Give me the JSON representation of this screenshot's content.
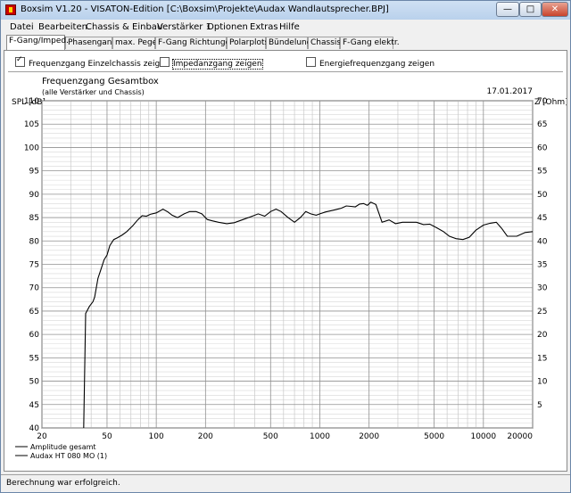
{
  "window": {
    "title": "Boxsim V1.20 - VISATON-Edition [C:\\Boxsim\\Projekte\\Audax Wandlautsprecher.BPJ]",
    "minimize": "—",
    "maximize": "□",
    "close": "✕"
  },
  "menu": [
    "Datei",
    "Bearbeiten",
    "Chassis & Einbau",
    "Verstärker 1",
    "Optionen",
    "Extras",
    "Hilfe"
  ],
  "tabs": [
    "F-Gang/Imped.",
    "Phasengang",
    "max. Pegel",
    "F-Gang Richtungen",
    "Polarplots",
    "Bündelung",
    "Chassis",
    "F-Gang elektr."
  ],
  "options": [
    {
      "label": "Frequenzgang Einzelchassis zeigen",
      "checked": true
    },
    {
      "label": "Impedanzgang zeigen",
      "checked": false
    },
    {
      "label": "Energiefrequenzgang zeigen",
      "checked": false
    }
  ],
  "status": "Berechnung war erfolgreich.",
  "chart_data": {
    "type": "line",
    "title": "Frequenzgang Gesamtbox",
    "subtitle": "(alle Verstärker und Chassis)",
    "date": "17.01.2017",
    "ylabel": "SPL [dB]",
    "y2label": "Z [Ohm]",
    "x_scale": "log",
    "xlim": [
      20,
      20000
    ],
    "ylim": [
      40,
      110
    ],
    "y2lim": [
      0,
      70
    ],
    "x_ticks": [
      20,
      50,
      100,
      200,
      500,
      1000,
      2000,
      5000,
      10000,
      20000
    ],
    "x_tick_labels": [
      "20",
      "50",
      "100",
      "200",
      "500",
      "1000",
      "2000",
      "5000",
      "10000",
      "20000"
    ],
    "y_ticks": [
      40,
      45,
      50,
      55,
      60,
      65,
      70,
      75,
      80,
      85,
      90,
      95,
      100,
      105,
      110
    ],
    "y2_ticks": [
      5,
      10,
      15,
      20,
      25,
      30,
      35,
      40,
      45,
      50,
      55,
      60,
      65,
      70
    ],
    "grid": true,
    "legend_position": "bottom-left",
    "series": [
      {
        "name": "Amplitude gesamt",
        "color": "#000000",
        "x": [
          36,
          37,
          39,
          41,
          42,
          44,
          46,
          48,
          50,
          52,
          55,
          58,
          62,
          66,
          72,
          77,
          82,
          87,
          92,
          100,
          110,
          118,
          125,
          135,
          148,
          160,
          175,
          190,
          205,
          220,
          240,
          270,
          300,
          340,
          380,
          420,
          460,
          500,
          540,
          580,
          640,
          700,
          760,
          820,
          880,
          950,
          1000,
          1080,
          1150,
          1250,
          1350,
          1450,
          1550,
          1650,
          1750,
          1850,
          1950,
          2050,
          2200,
          2400,
          2650,
          2900,
          3200,
          3500,
          3900,
          4300,
          4700,
          5200,
          5700,
          6200,
          6800,
          7500,
          8200,
          9000,
          10000,
          11000,
          12000,
          13000,
          14000,
          16000,
          18000,
          20000
        ],
        "y": [
          40,
          64.5,
          66,
          67,
          68,
          72,
          74,
          76,
          77,
          79,
          80.3,
          80.7,
          81.3,
          82,
          83.3,
          84.5,
          85.4,
          85.3,
          85.7,
          86,
          86.8,
          86.2,
          85.5,
          85,
          85.8,
          86.3,
          86.3,
          85.8,
          84.6,
          84.3,
          84,
          83.7,
          83.9,
          84.6,
          85.2,
          85.8,
          85.3,
          86.3,
          86.8,
          86.3,
          85,
          84,
          85,
          86.3,
          85.8,
          85.5,
          85.8,
          86.2,
          86.4,
          86.7,
          87,
          87.5,
          87.4,
          87.3,
          87.9,
          88,
          87.6,
          88.3,
          87.8,
          84,
          84.5,
          83.7,
          84,
          84,
          84,
          83.5,
          83.6,
          82.8,
          82,
          81,
          80.5,
          80.3,
          80.8,
          82.3,
          83.4,
          83.8,
          84,
          82.6,
          81,
          81,
          81.8,
          82
        ]
      },
      {
        "name": "Audax HT 080 MO (1)",
        "color": "#000000",
        "x": [],
        "y": []
      }
    ]
  }
}
